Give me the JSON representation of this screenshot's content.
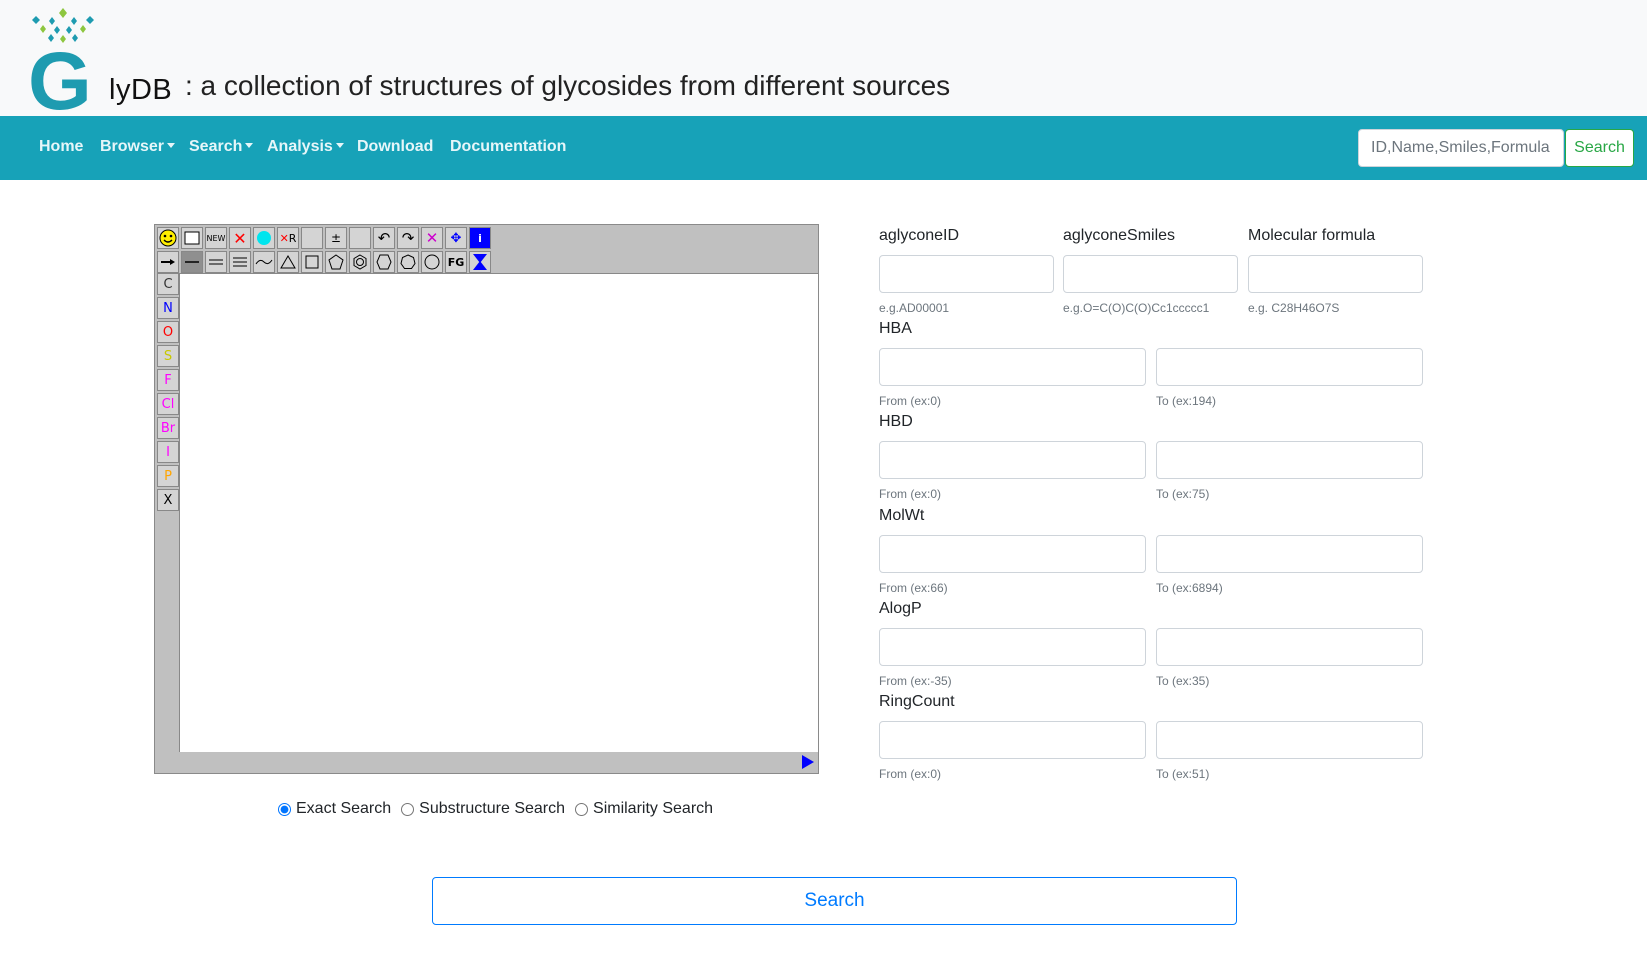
{
  "header": {
    "brand_initial": "G",
    "brand_rest": "lyDB",
    "tagline": ": a collection of structures of glycosides from different sources"
  },
  "nav": {
    "items": [
      {
        "label": "Home",
        "dropdown": false
      },
      {
        "label": "Browser",
        "dropdown": true
      },
      {
        "label": "Search",
        "dropdown": true
      },
      {
        "label": "Analysis",
        "dropdown": true
      },
      {
        "label": "Download",
        "dropdown": false
      },
      {
        "label": "Documentation",
        "dropdown": false
      }
    ],
    "search_placeholder": "ID,Name,Smiles,Formula",
    "search_button": "Search"
  },
  "editor": {
    "new_label": "NEW",
    "r_label": "R",
    "fg_label": "FG",
    "info_label": "i",
    "elements": [
      {
        "symbol": "C",
        "color": "#333333"
      },
      {
        "symbol": "N",
        "color": "#0000ff"
      },
      {
        "symbol": "O",
        "color": "#ff0000"
      },
      {
        "symbol": "S",
        "color": "#c8c800"
      },
      {
        "symbol": "F",
        "color": "#ff00ff"
      },
      {
        "symbol": "Cl",
        "color": "#ff00ff"
      },
      {
        "symbol": "Br",
        "color": "#ff00ff"
      },
      {
        "symbol": "I",
        "color": "#ff00ff"
      },
      {
        "symbol": "P",
        "color": "#ffa500"
      },
      {
        "symbol": "X",
        "color": "#000000"
      }
    ]
  },
  "search_mode": {
    "options": [
      "Exact Search",
      "Substructure Search",
      "Similarity Search"
    ],
    "selected": "Exact Search"
  },
  "form": {
    "aglycone_id": {
      "label": "aglyconeID",
      "hint": "e.g.AD00001"
    },
    "aglycone_smiles": {
      "label": "aglyconeSmiles",
      "hint": "e.g.O=C(O)C(O)Cc1ccccc1"
    },
    "molecular_formula": {
      "label": "Molecular formula",
      "hint": "e.g. C28H46O7S"
    },
    "ranges": [
      {
        "label": "HBA",
        "from_hint": "From (ex:0)",
        "to_hint": "To (ex:194)"
      },
      {
        "label": "HBD",
        "from_hint": "From (ex:0)",
        "to_hint": "To (ex:75)"
      },
      {
        "label": "MolWt",
        "from_hint": "From (ex:66)",
        "to_hint": "To (ex:6894)"
      },
      {
        "label": "AlogP",
        "from_hint": "From (ex:-35)",
        "to_hint": "To (ex:35)"
      },
      {
        "label": "RingCount",
        "from_hint": "From (ex:0)",
        "to_hint": "To (ex:51)"
      }
    ]
  },
  "submit": {
    "label": "Search"
  },
  "colors": {
    "navbar": "#17a2b8",
    "logo_teal": "#1e9bb0",
    "logo_green": "#8dc63f",
    "primary": "#007bff",
    "success": "#28a745"
  }
}
